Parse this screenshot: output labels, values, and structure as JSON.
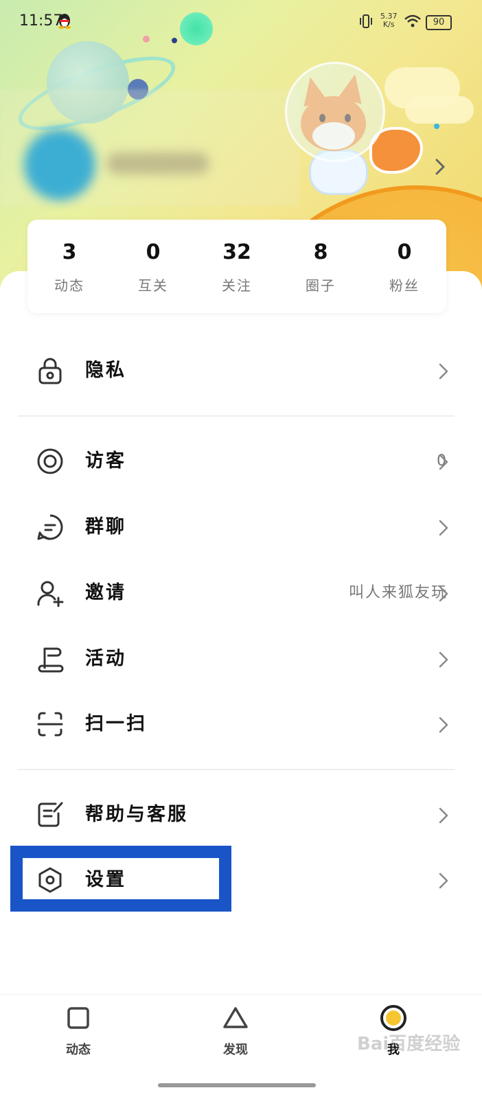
{
  "status_bar": {
    "time": "11:57",
    "net_speed": "5.37",
    "net_unit": "K/s",
    "battery": "90"
  },
  "stats": [
    {
      "value": "3",
      "label": "动态"
    },
    {
      "value": "0",
      "label": "互关"
    },
    {
      "value": "32",
      "label": "关注"
    },
    {
      "value": "8",
      "label": "圈子"
    },
    {
      "value": "0",
      "label": "粉丝"
    }
  ],
  "menu": {
    "privacy": {
      "label": "隐私"
    },
    "visitors": {
      "label": "访客",
      "extra": "0"
    },
    "group_chat": {
      "label": "群聊"
    },
    "invite": {
      "label": "邀请",
      "extra": "叫人来狐友玩"
    },
    "activity": {
      "label": "活动"
    },
    "scan": {
      "label": "扫一扫"
    },
    "help": {
      "label": "帮助与客服"
    },
    "settings": {
      "label": "设置"
    }
  },
  "tabs": [
    {
      "label": "动态",
      "icon": "square-icon"
    },
    {
      "label": "发现",
      "icon": "triangle-icon"
    },
    {
      "label": "我",
      "icon": "circle-icon"
    }
  ],
  "watermark": "Bai百度经验",
  "colors": {
    "highlight": "#1a55c8",
    "accent_yellow": "#f7c52f"
  }
}
